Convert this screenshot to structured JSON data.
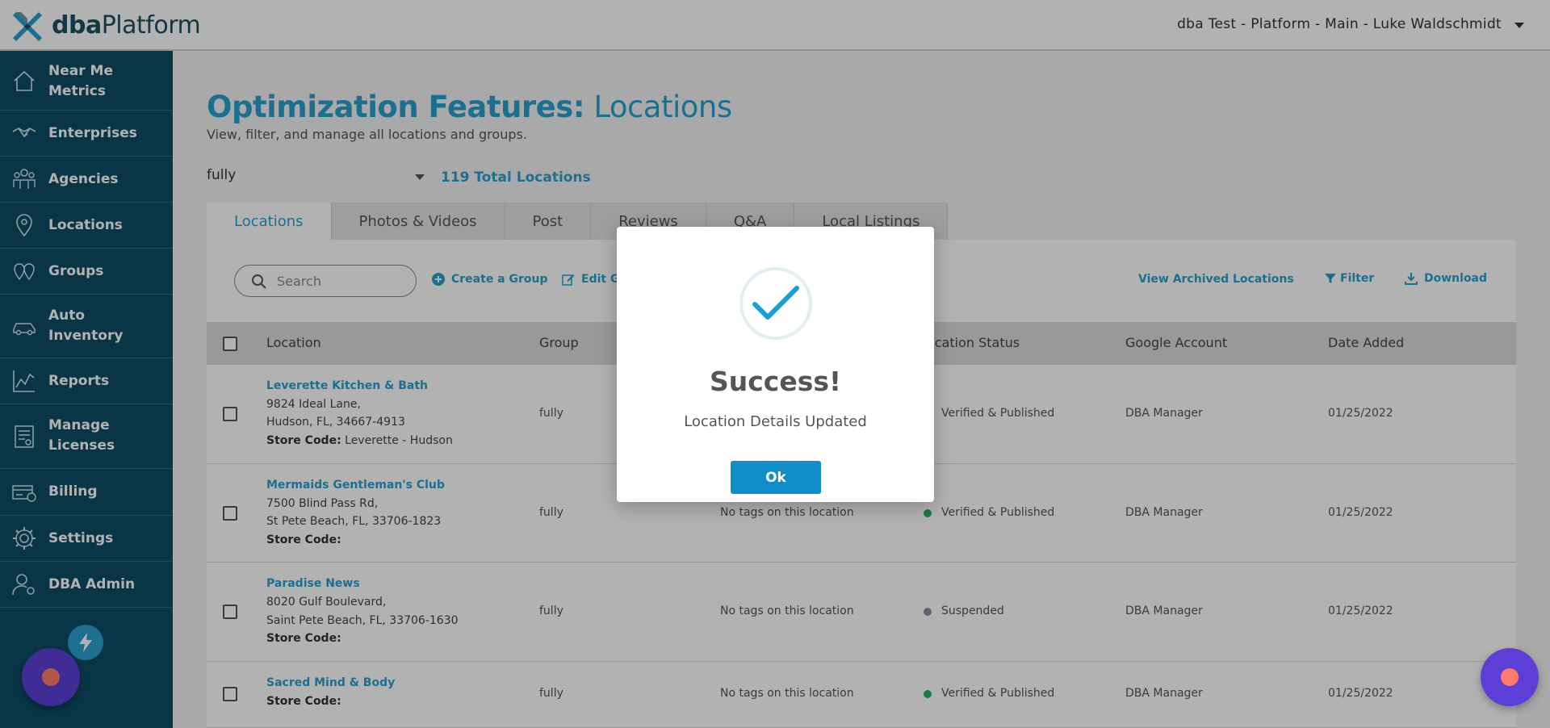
{
  "app": {
    "logo_prefix": "dba",
    "logo_suffix": "Platform",
    "account_label": "dba Test - Platform - Main - Luke Waldschmidt"
  },
  "sidebar": {
    "items": [
      {
        "label": "Near Me\nMetrics",
        "icon": "home-icon"
      },
      {
        "label": "Enterprises",
        "icon": "handshake-icon"
      },
      {
        "label": "Agencies",
        "icon": "people-icon"
      },
      {
        "label": "Locations",
        "icon": "map-pin-icon"
      },
      {
        "label": "Groups",
        "icon": "group-pins-icon"
      },
      {
        "label": "Auto\nInventory",
        "icon": "car-icon"
      },
      {
        "label": "Reports",
        "icon": "chart-line-icon"
      },
      {
        "label": "Manage\nLicenses",
        "icon": "license-icon"
      },
      {
        "label": "Billing",
        "icon": "billing-icon"
      },
      {
        "label": "Settings",
        "icon": "gear-icon"
      },
      {
        "label": "DBA Admin",
        "icon": "admin-user-icon"
      }
    ]
  },
  "page": {
    "title_bold": "Optimization Features:",
    "title_light": " Locations",
    "subtitle": "View, filter, and manage all locations and groups.",
    "filter_value": "fully",
    "total_locations": "119 Total Locations"
  },
  "tabs": [
    {
      "label": "Locations",
      "active": true
    },
    {
      "label": "Photos & Videos",
      "active": false
    },
    {
      "label": "Post",
      "active": false
    },
    {
      "label": "Reviews",
      "active": false
    },
    {
      "label": "Q&A",
      "active": false
    },
    {
      "label": "Local Listings",
      "active": false
    }
  ],
  "toolbar": {
    "search_placeholder": "Search",
    "create_group": "Create a Group",
    "edit_group": "Edit G",
    "view_archived": "View Archived Locations",
    "filter": "Filter",
    "download": "Download"
  },
  "table": {
    "headers": {
      "location": "Location",
      "group": "Group",
      "location_status": "ocation Status",
      "google_account": "Google Account",
      "date_added": "Date Added"
    },
    "rows": [
      {
        "name": "Leverette Kitchen & Bath",
        "address1": "9824 Ideal Lane,",
        "address2": "Hudson, FL, 34667-4913",
        "store_code_label": "Store Code:",
        "store_code": " Leverette - Hudson",
        "group": "fully",
        "tags": "",
        "status": "Verified & Published",
        "status_color": "#27ae60",
        "google_account": "DBA Manager",
        "date_added": "01/25/2022"
      },
      {
        "name": "Mermaids Gentleman's Club",
        "address1": "7500 Blind Pass Rd,",
        "address2": "St Pete Beach, FL, 33706-1823",
        "store_code_label": "Store Code:",
        "store_code": "",
        "group": "fully",
        "tags": "No tags on this location",
        "status": "Verified & Published",
        "status_color": "#27ae60",
        "google_account": "DBA Manager",
        "date_added": "01/25/2022"
      },
      {
        "name": "Paradise News",
        "address1": "8020 Gulf Boulevard,",
        "address2": "Saint Pete Beach, FL, 33706-1630",
        "store_code_label": "Store Code:",
        "store_code": "",
        "group": "fully",
        "tags": "No tags on this location",
        "status": "Suspended",
        "status_color": "#8a8fa8",
        "google_account": "DBA Manager",
        "date_added": "01/25/2022"
      },
      {
        "name": "Sacred Mind & Body",
        "address1": "",
        "address2": "",
        "store_code_label": "Store Code:",
        "store_code": "",
        "group": "fully",
        "tags": "No tags on this location",
        "status": "Verified & Published",
        "status_color": "#27ae60",
        "google_account": "DBA Manager",
        "date_added": "01/25/2022"
      }
    ]
  },
  "modal": {
    "title": "Success!",
    "message": "Location Details Updated",
    "ok_label": "Ok"
  },
  "colors": {
    "accent": "#2a9fcf",
    "sidebar_bg": "#0d4d66",
    "ok_button": "#0f8ec9",
    "record_button": "#5b3fd6"
  }
}
